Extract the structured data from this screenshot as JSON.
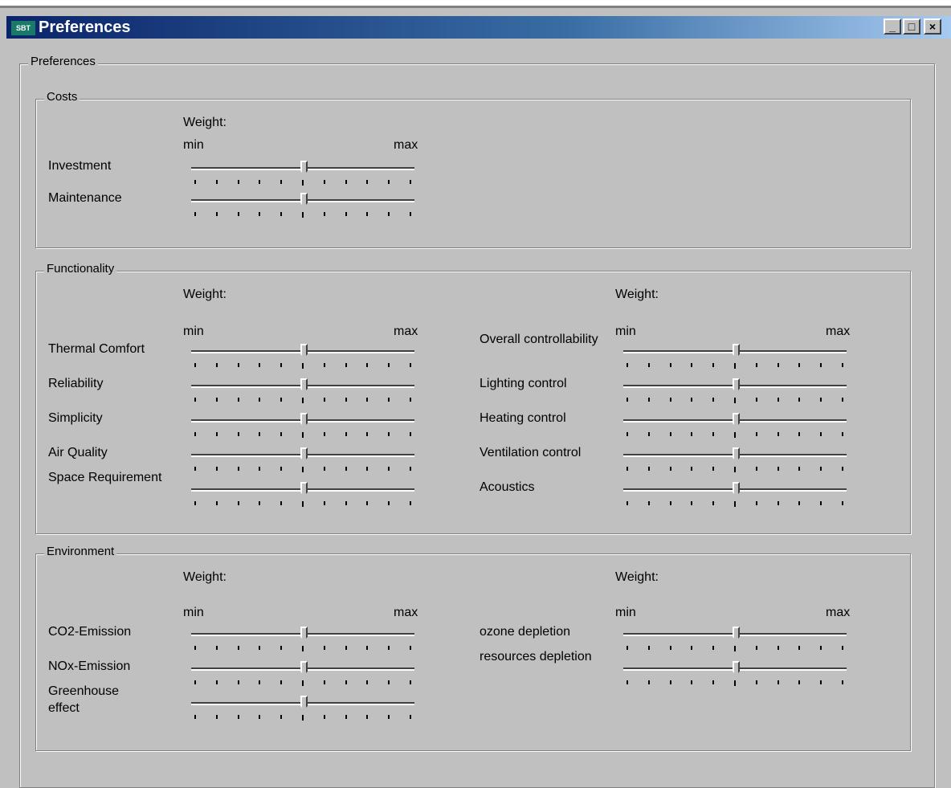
{
  "window": {
    "title": "Preferences",
    "icon_text": "SBT",
    "buttons": {
      "minimize": "_",
      "maximize": "□",
      "close": "×"
    }
  },
  "outer_group": {
    "label": "Preferences"
  },
  "costs": {
    "label": "Costs",
    "weight_label": "Weight:",
    "min_label": "min",
    "max_label": "max",
    "rows": [
      {
        "label": "Investment",
        "value": 0.5
      },
      {
        "label": "Maintenance",
        "value": 0.5
      }
    ]
  },
  "functionality": {
    "label": "Functionality",
    "left": {
      "weight_label": "Weight:",
      "min_label": "min",
      "max_label": "max",
      "rows": [
        {
          "label": "Thermal Comfort",
          "value": 0.5
        },
        {
          "label": "Reliability",
          "value": 0.5
        },
        {
          "label": "Simplicity",
          "value": 0.5
        },
        {
          "label": "Air Quality",
          "value": 0.5
        },
        {
          "label": "Space Requirement",
          "value": 0.5
        }
      ]
    },
    "right": {
      "weight_label": "Weight:",
      "min_label": "min",
      "max_label": "max",
      "rows": [
        {
          "label": "Overall controllability",
          "value": 0.5
        },
        {
          "label": "Lighting control",
          "value": 0.5
        },
        {
          "label": "Heating control",
          "value": 0.5
        },
        {
          "label": "Ventilation control",
          "value": 0.5
        },
        {
          "label": "Acoustics",
          "value": 0.5
        }
      ]
    }
  },
  "environment": {
    "label": "Environment",
    "left": {
      "weight_label": "Weight:",
      "min_label": "min",
      "max_label": "max",
      "rows": [
        {
          "label": "CO2-Emission",
          "value": 0.5
        },
        {
          "label": "NOx-Emission",
          "value": 0.5
        },
        {
          "label": "Greenhouse effect",
          "value": 0.5
        }
      ]
    },
    "right": {
      "weight_label": "Weight:",
      "min_label": "min",
      "max_label": "max",
      "rows": [
        {
          "label": "ozone depletion",
          "value": 0.5
        },
        {
          "label": "resources depletion",
          "value": 0.5
        }
      ]
    }
  }
}
